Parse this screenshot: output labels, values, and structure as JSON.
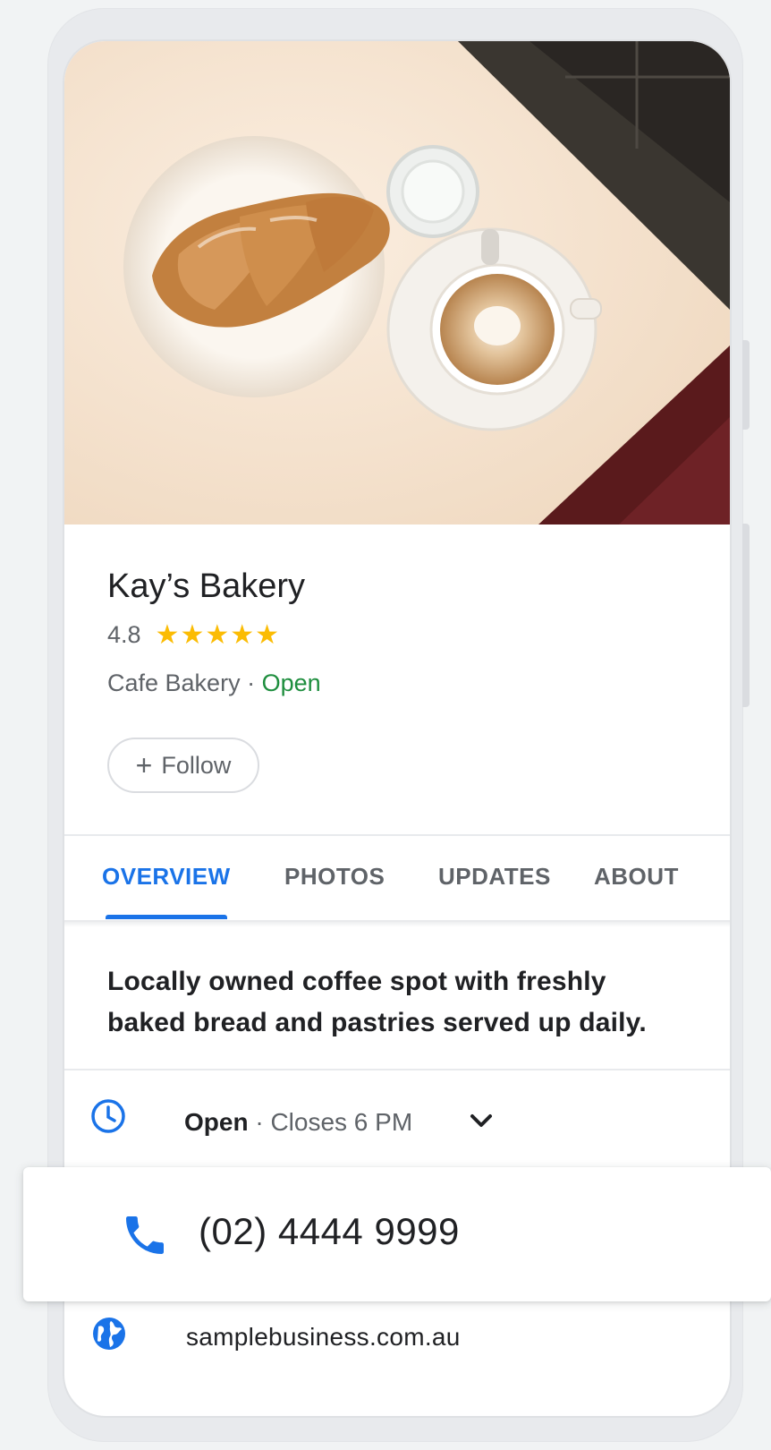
{
  "business": {
    "name": "Kay’s Bakery",
    "rating": "4.8",
    "stars": "★★★★★",
    "category": "Cafe Bakery",
    "separator": " · ",
    "status": "Open"
  },
  "follow_button": {
    "icon": "+",
    "label": "Follow"
  },
  "tabs": [
    {
      "label": "OVERVIEW",
      "active": true
    },
    {
      "label": "PHOTOS",
      "active": false
    },
    {
      "label": "UPDATES",
      "active": false
    },
    {
      "label": "ABOUT",
      "active": false
    }
  ],
  "description": "Locally owned coffee spot with freshly baked bread and pastries served up daily.",
  "hours": {
    "icon": "clock-icon",
    "status": "Open",
    "detail": " · Closes 6 PM",
    "expand_icon": "chevron-down-icon"
  },
  "phone": {
    "icon": "phone-icon",
    "number": "(02) 4444 9999"
  },
  "website": {
    "icon": "globe-icon",
    "url": "samplebusiness.com.au"
  },
  "colors": {
    "accent": "#1a73e8",
    "open_green": "#1e8e3e",
    "star": "#fbbc04",
    "secondary_text": "#5f6368",
    "primary_text": "#202124"
  }
}
